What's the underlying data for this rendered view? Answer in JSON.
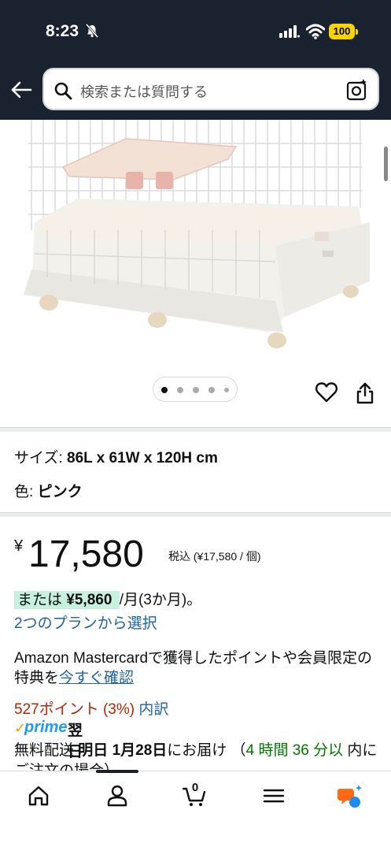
{
  "status": {
    "time": "8:23",
    "battery": "100"
  },
  "header": {
    "search_placeholder": "検索または質問する"
  },
  "gallery": {
    "image_count": 5,
    "active_index": 0
  },
  "specs": {
    "size_label": "サイズ:",
    "size_value": "86L x 61W x 120H cm",
    "color_label": "色:",
    "color_value": "ピンク"
  },
  "price": {
    "symbol": "¥",
    "amount": "17,580",
    "tax_note": "税込 (¥17,580 / 個)"
  },
  "installment": {
    "prefix": "または",
    "amount": "¥5,860",
    "suffix": "/月(3か月)。",
    "plan_link": "2つのプランから選択"
  },
  "promo": {
    "text": "Amazon Mastercardで獲得したポイントや会員限定の特典を",
    "link": "今すぐ確認"
  },
  "points": {
    "text": "527ポイント (3%)",
    "link": "内訳"
  },
  "prime": {
    "check": "✓",
    "label": "prime",
    "next_day": "翌日"
  },
  "delivery": {
    "free_shipping": "無料配送",
    "date": "明日 1月28日",
    "deliver_text": "にお届け",
    "open_paren": "（",
    "countdown": "4 時間 36 分以",
    "cutoff": "内にご注文の場合）"
  },
  "bottom_nav": {
    "cart_count": "0"
  }
}
